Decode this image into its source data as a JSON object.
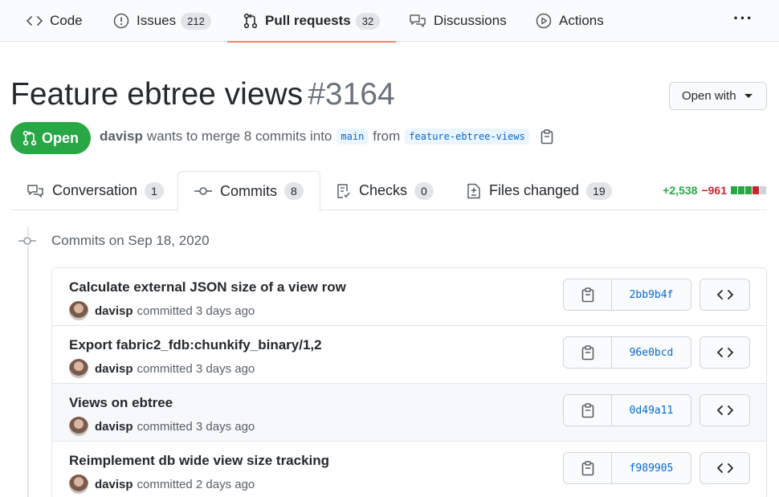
{
  "repo_nav": {
    "code_label": "Code",
    "issues_label": "Issues",
    "issues_count": "212",
    "pulls_label": "Pull requests",
    "pulls_count": "32",
    "discussions_label": "Discussions",
    "actions_label": "Actions",
    "more_label": "···"
  },
  "pr": {
    "title": "Feature ebtree views",
    "number": "#3164",
    "open_with_label": "Open with",
    "state": "Open",
    "author": "davisp",
    "merge_text": "wants to merge 8 commits into",
    "base_branch": "main",
    "from_text": "from",
    "head_branch": "feature-ebtree-views"
  },
  "tabs": [
    {
      "label": "Conversation",
      "count": "1"
    },
    {
      "label": "Commits",
      "count": "8"
    },
    {
      "label": "Checks",
      "count": "0"
    },
    {
      "label": "Files changed",
      "count": "19"
    }
  ],
  "diffstat": {
    "additions": "+2,538",
    "deletions": "−961",
    "block_colors": [
      "#28a745",
      "#28a745",
      "#28a745",
      "#cb2431",
      "#d1d5da"
    ]
  },
  "commits_group": {
    "date_label": "Commits on Sep 18, 2020"
  },
  "commits": [
    {
      "message": "Calculate external JSON size of a view row",
      "author": "davisp",
      "action": "committed",
      "time": "3 days ago",
      "sha": "2bb9b4f"
    },
    {
      "message": "Export fabric2_fdb:chunkify_binary/1,2",
      "author": "davisp",
      "action": "committed",
      "time": "3 days ago",
      "sha": "96e0bcd"
    },
    {
      "message": "Views on ebtree",
      "author": "davisp",
      "action": "committed",
      "time": "3 days ago",
      "sha": "0d49a11"
    },
    {
      "message": "Reimplement db wide view size tracking",
      "author": "davisp",
      "action": "committed",
      "time": "2 days ago",
      "sha": "f989905"
    }
  ],
  "colors": {
    "accent_tab_underline": "#f9826c",
    "open_green": "#28a745",
    "link_blue": "#0366d6"
  }
}
